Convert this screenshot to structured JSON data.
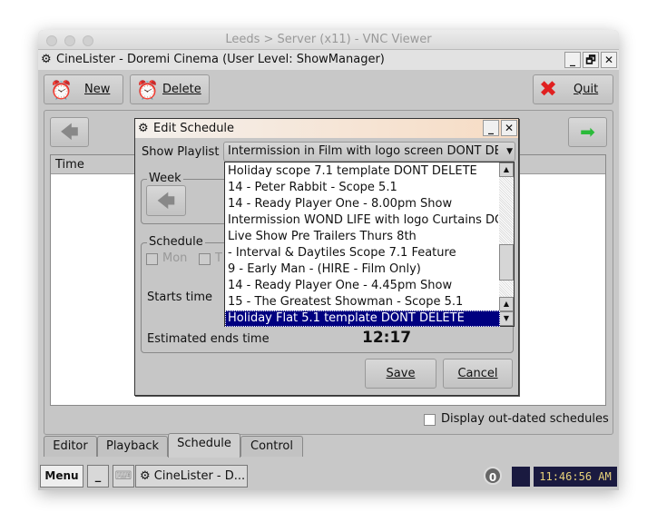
{
  "mac_window": {
    "title": "Leeds > Server (x11) - VNC Viewer"
  },
  "app": {
    "title": "CineLister - Doremi Cinema (User Level: ShowManager)",
    "min": "_",
    "restore": "🗗",
    "close": "✕"
  },
  "toolbar": {
    "new": "New",
    "delete": "Delete",
    "quit": "Quit"
  },
  "table": {
    "header": "Time"
  },
  "outdated_label": "Display out-dated schedules",
  "tabs": [
    {
      "label": "Editor"
    },
    {
      "label": "Playback"
    },
    {
      "label": "Schedule",
      "active": true
    },
    {
      "label": "Control"
    }
  ],
  "taskbar": {
    "menu": "Menu",
    "minimize": "_",
    "task": "CineLister - D...",
    "badge": "0",
    "clock": "11:46:56 AM"
  },
  "dialog": {
    "title": "Edit Schedule",
    "playlist_label": "Show Playlist",
    "playlist_value": "Intermission in Film with logo screen DONT DELETE",
    "week_label": "Week",
    "schedule_label": "Schedule",
    "day_mon": "Mon",
    "day_tue": "T",
    "starts_label": "Starts time",
    "ends_label": "Estimated ends time",
    "ends_value": "12:17",
    "save": "Save",
    "cancel": "Cancel",
    "options": [
      "Holiday scope 7.1 template DONT DELETE",
      "14 - Peter Rabbit - Scope 5.1",
      "14 - Ready Player One - 8.00pm Show",
      "Intermission WOND LIFE with logo Curtains DONT",
      "Live Show Pre Trailers Thurs 8th",
      "- Interval & Daytiles Scope 7.1 Feature",
      "9 - Early Man - (HIRE - Film Only)",
      "14 - Ready Player One - 4.45pm Show",
      "15 - The Greatest Showman - Scope 5.1",
      "Holiday Flat 5.1 template DONT DELETE"
    ],
    "selected_index": 9
  },
  "colors": {
    "selection": "#000080",
    "clock_bg": "#1a1a40",
    "clock_fg": "#e8d27a"
  }
}
